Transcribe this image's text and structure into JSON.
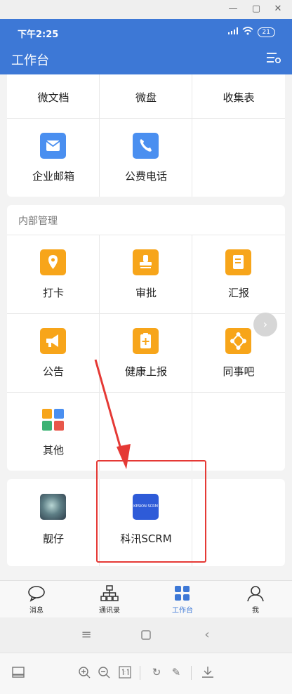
{
  "status": {
    "time": "下午2:25",
    "battery": "21"
  },
  "header": {
    "title": "工作台"
  },
  "section_top": {
    "items": [
      "微文档",
      "微盘",
      "收集表",
      "企业邮箱",
      "公费电话"
    ]
  },
  "section_internal": {
    "title": "内部管理",
    "items": [
      "打卡",
      "审批",
      "汇报",
      "公告",
      "健康上报",
      "同事吧",
      "其他"
    ]
  },
  "section_apps": {
    "items": [
      "靓仔",
      "科汛SCRM"
    ],
    "scrm_logo_text": "KESION SCRM"
  },
  "tabs": [
    "消息",
    "通讯录",
    "工作台",
    "我"
  ],
  "colors": {
    "header": "#3d78d6",
    "highlight": "#e53935",
    "icon_blue": "#4a8ff0",
    "icon_orange": "#f7a51a"
  }
}
